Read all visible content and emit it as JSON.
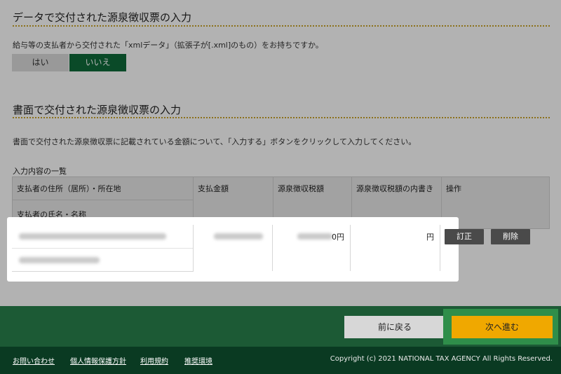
{
  "section1": {
    "title": "データで交付された源泉徴収票の入力",
    "question": "給与等の支払者から交付された「xmlデータ」（拡張子が[.xml]のもの）をお持ちですか。",
    "yes_label": "はい",
    "no_label": "いいえ",
    "selected": "いいえ"
  },
  "section2": {
    "title": "書面で交付された源泉徴収票の入力",
    "instruction": "書面で交付された源泉徴収票に記載されている金額について、「入力する」ボタンをクリックして入力してください。"
  },
  "table": {
    "caption": "入力内容の一覧",
    "headers": {
      "payer_address": "支払者の住所（居所）・所在地",
      "payer_name": "支払者の氏名・名称",
      "payment_amount": "支払金額",
      "withholding_tax": "源泉徴収税額",
      "withholding_breakdown": "源泉徴収税額の内書き",
      "operation": "操作"
    },
    "row": {
      "withholding_tax_suffix": "0円",
      "breakdown_value": "円",
      "edit_label": "訂正",
      "delete_label": "削除"
    }
  },
  "nav": {
    "back_label": "前に戻る",
    "next_label": "次へ進む"
  },
  "footer": {
    "links": [
      "お問い合わせ",
      "個人情報保護方針",
      "利用規約",
      "推奨環境"
    ],
    "copyright": "Copyright (c) 2021 NATIONAL TAX AGENCY All Rights Reserved."
  },
  "colors": {
    "accent_green": "#0f6b3a",
    "footer_green": "#1c5a35",
    "next_button": "#f0a800",
    "divider_gold": "#c9a227"
  }
}
